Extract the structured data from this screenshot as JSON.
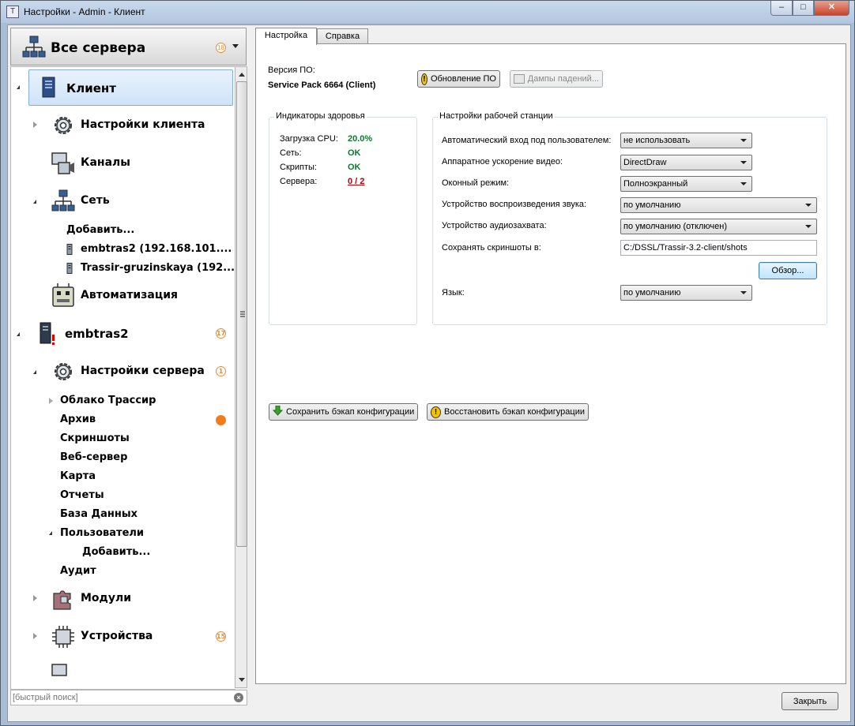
{
  "window": {
    "title": "Настройки - Admin - Клиент",
    "minimize": "–",
    "maximize": "□",
    "close": "✕"
  },
  "left": {
    "all_servers": {
      "label": "Все сервера",
      "badge": "18"
    },
    "tree": [
      {
        "label": "Клиент"
      },
      {
        "label": "Настройки клиента"
      },
      {
        "label": "Каналы"
      },
      {
        "label": "Сеть"
      },
      {
        "label": "Добавить..."
      },
      {
        "label": "embtras2 (192.168.101...."
      },
      {
        "label": "Trassir-gruzinskaya (192..."
      },
      {
        "label": "Автоматизация"
      },
      {
        "label": "embtras2",
        "badge": "17"
      },
      {
        "label": "Настройки сервера",
        "badge": "1"
      },
      {
        "label": "Облако Трассир"
      },
      {
        "label": "Архив"
      },
      {
        "label": "Скриншоты"
      },
      {
        "label": "Веб-сервер"
      },
      {
        "label": "Карта"
      },
      {
        "label": "Отчеты"
      },
      {
        "label": "База Данных"
      },
      {
        "label": "Пользователи"
      },
      {
        "label": "Добавить..."
      },
      {
        "label": "Аудит"
      },
      {
        "label": "Модули"
      },
      {
        "label": "Устройства",
        "badge": "15"
      }
    ],
    "search_placeholder": "[быстрый поиск]"
  },
  "tabs": [
    {
      "label": "Настройка",
      "active": true
    },
    {
      "label": "Справка",
      "active": false
    }
  ],
  "settings": {
    "version_label": "Версия ПО:",
    "version_value": "Service Pack 6664 (Client)",
    "update_button": "Обновление ПО",
    "dumps_button": "Дампы падений...",
    "health": {
      "title": "Индикаторы здоровья",
      "rows": [
        {
          "label": "Загрузка CPU:",
          "value": "20.0%"
        },
        {
          "label": "Сеть:",
          "value": "OK"
        },
        {
          "label": "Скрипты:",
          "value": "OK"
        },
        {
          "label": "Сервера:",
          "value": "0 / 2"
        }
      ]
    },
    "workstation": {
      "title": "Настройки рабочей станции",
      "autologin_label": "Автоматический вход под пользователем:",
      "autologin_value": "не использовать",
      "video_accel_label": "Аппаратное ускорение видео:",
      "video_accel_value": "DirectDraw",
      "window_mode_label": "Оконный режим:",
      "window_mode_value": "Полноэкранный",
      "audio_out_label": "Устройство воспроизведения звука:",
      "audio_out_value": "по умолчанию",
      "audio_in_label": "Устройство аудиозахвата:",
      "audio_in_value": "по умолчанию (отключен)",
      "screenshots_label": "Сохранять скриншоты в:",
      "screenshots_value": "C:/DSSL/Trassir-3.2-client/shots",
      "browse_button": "Обзор...",
      "language_label": "Язык:",
      "language_value": "по умолчанию"
    },
    "backup_save_button": "Сохранить бэкап конфигурации",
    "backup_restore_button": "Восстановить бэкап конфигурации"
  },
  "footer": {
    "close_button": "Закрыть"
  },
  "colors": {
    "ok": "#0d7a2e",
    "error": "#b8000a",
    "badge": "#f08a2c",
    "selection": "#cfe3f8"
  }
}
